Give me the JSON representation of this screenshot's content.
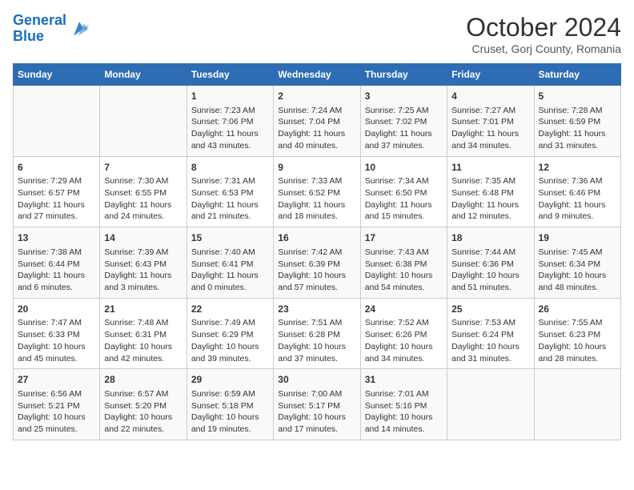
{
  "header": {
    "logo_line1": "General",
    "logo_line2": "Blue",
    "month": "October 2024",
    "location": "Cruset, Gorj County, Romania"
  },
  "columns": [
    "Sunday",
    "Monday",
    "Tuesday",
    "Wednesday",
    "Thursday",
    "Friday",
    "Saturday"
  ],
  "weeks": [
    [
      {
        "day": "",
        "info": ""
      },
      {
        "day": "",
        "info": ""
      },
      {
        "day": "1",
        "info": "Sunrise: 7:23 AM\nSunset: 7:06 PM\nDaylight: 11 hours and 43 minutes."
      },
      {
        "day": "2",
        "info": "Sunrise: 7:24 AM\nSunset: 7:04 PM\nDaylight: 11 hours and 40 minutes."
      },
      {
        "day": "3",
        "info": "Sunrise: 7:25 AM\nSunset: 7:02 PM\nDaylight: 11 hours and 37 minutes."
      },
      {
        "day": "4",
        "info": "Sunrise: 7:27 AM\nSunset: 7:01 PM\nDaylight: 11 hours and 34 minutes."
      },
      {
        "day": "5",
        "info": "Sunrise: 7:28 AM\nSunset: 6:59 PM\nDaylight: 11 hours and 31 minutes."
      }
    ],
    [
      {
        "day": "6",
        "info": "Sunrise: 7:29 AM\nSunset: 6:57 PM\nDaylight: 11 hours and 27 minutes."
      },
      {
        "day": "7",
        "info": "Sunrise: 7:30 AM\nSunset: 6:55 PM\nDaylight: 11 hours and 24 minutes."
      },
      {
        "day": "8",
        "info": "Sunrise: 7:31 AM\nSunset: 6:53 PM\nDaylight: 11 hours and 21 minutes."
      },
      {
        "day": "9",
        "info": "Sunrise: 7:33 AM\nSunset: 6:52 PM\nDaylight: 11 hours and 18 minutes."
      },
      {
        "day": "10",
        "info": "Sunrise: 7:34 AM\nSunset: 6:50 PM\nDaylight: 11 hours and 15 minutes."
      },
      {
        "day": "11",
        "info": "Sunrise: 7:35 AM\nSunset: 6:48 PM\nDaylight: 11 hours and 12 minutes."
      },
      {
        "day": "12",
        "info": "Sunrise: 7:36 AM\nSunset: 6:46 PM\nDaylight: 11 hours and 9 minutes."
      }
    ],
    [
      {
        "day": "13",
        "info": "Sunrise: 7:38 AM\nSunset: 6:44 PM\nDaylight: 11 hours and 6 minutes."
      },
      {
        "day": "14",
        "info": "Sunrise: 7:39 AM\nSunset: 6:43 PM\nDaylight: 11 hours and 3 minutes."
      },
      {
        "day": "15",
        "info": "Sunrise: 7:40 AM\nSunset: 6:41 PM\nDaylight: 11 hours and 0 minutes."
      },
      {
        "day": "16",
        "info": "Sunrise: 7:42 AM\nSunset: 6:39 PM\nDaylight: 10 hours and 57 minutes."
      },
      {
        "day": "17",
        "info": "Sunrise: 7:43 AM\nSunset: 6:38 PM\nDaylight: 10 hours and 54 minutes."
      },
      {
        "day": "18",
        "info": "Sunrise: 7:44 AM\nSunset: 6:36 PM\nDaylight: 10 hours and 51 minutes."
      },
      {
        "day": "19",
        "info": "Sunrise: 7:45 AM\nSunset: 6:34 PM\nDaylight: 10 hours and 48 minutes."
      }
    ],
    [
      {
        "day": "20",
        "info": "Sunrise: 7:47 AM\nSunset: 6:33 PM\nDaylight: 10 hours and 45 minutes."
      },
      {
        "day": "21",
        "info": "Sunrise: 7:48 AM\nSunset: 6:31 PM\nDaylight: 10 hours and 42 minutes."
      },
      {
        "day": "22",
        "info": "Sunrise: 7:49 AM\nSunset: 6:29 PM\nDaylight: 10 hours and 39 minutes."
      },
      {
        "day": "23",
        "info": "Sunrise: 7:51 AM\nSunset: 6:28 PM\nDaylight: 10 hours and 37 minutes."
      },
      {
        "day": "24",
        "info": "Sunrise: 7:52 AM\nSunset: 6:26 PM\nDaylight: 10 hours and 34 minutes."
      },
      {
        "day": "25",
        "info": "Sunrise: 7:53 AM\nSunset: 6:24 PM\nDaylight: 10 hours and 31 minutes."
      },
      {
        "day": "26",
        "info": "Sunrise: 7:55 AM\nSunset: 6:23 PM\nDaylight: 10 hours and 28 minutes."
      }
    ],
    [
      {
        "day": "27",
        "info": "Sunrise: 6:56 AM\nSunset: 5:21 PM\nDaylight: 10 hours and 25 minutes."
      },
      {
        "day": "28",
        "info": "Sunrise: 6:57 AM\nSunset: 5:20 PM\nDaylight: 10 hours and 22 minutes."
      },
      {
        "day": "29",
        "info": "Sunrise: 6:59 AM\nSunset: 5:18 PM\nDaylight: 10 hours and 19 minutes."
      },
      {
        "day": "30",
        "info": "Sunrise: 7:00 AM\nSunset: 5:17 PM\nDaylight: 10 hours and 17 minutes."
      },
      {
        "day": "31",
        "info": "Sunrise: 7:01 AM\nSunset: 5:16 PM\nDaylight: 10 hours and 14 minutes."
      },
      {
        "day": "",
        "info": ""
      },
      {
        "day": "",
        "info": ""
      }
    ]
  ]
}
